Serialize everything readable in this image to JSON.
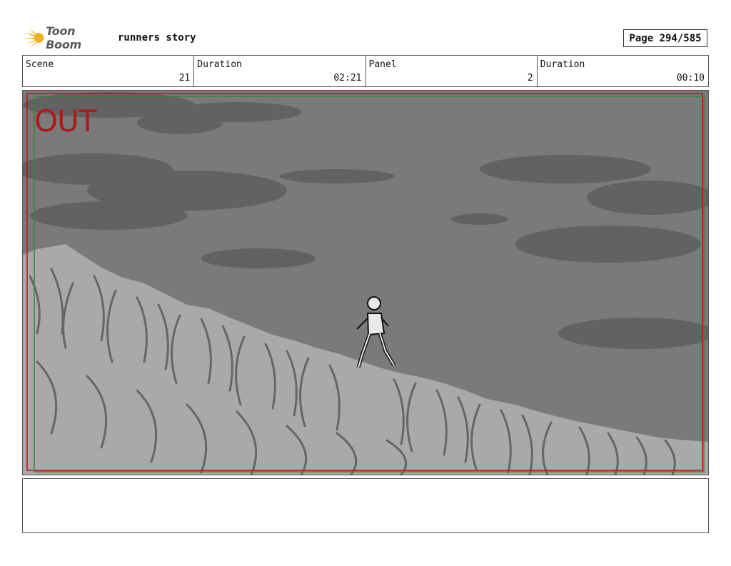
{
  "header": {
    "logo_text": "Toon Boom",
    "project_title": "runners story",
    "page_label": "Page 294/585"
  },
  "info_bar": [
    {
      "label": "Scene",
      "value": "21"
    },
    {
      "label": "Duration",
      "value": "02:21"
    },
    {
      "label": "Panel",
      "value": "2"
    },
    {
      "label": "Duration",
      "value": "00:10"
    }
  ],
  "panel": {
    "overlay_text": "OUT",
    "colors": {
      "sky": "#7a7a7a",
      "clouds": "#5e5e5e",
      "grass": "#a9a9a9",
      "grass_strokes": "#666666",
      "safe_frame_red": "#b01818",
      "safe_frame_green": "#2e8b2e",
      "out_text": "#b01818"
    },
    "icons": [
      "toon-boom-logo"
    ]
  },
  "notes": {
    "text": ""
  }
}
